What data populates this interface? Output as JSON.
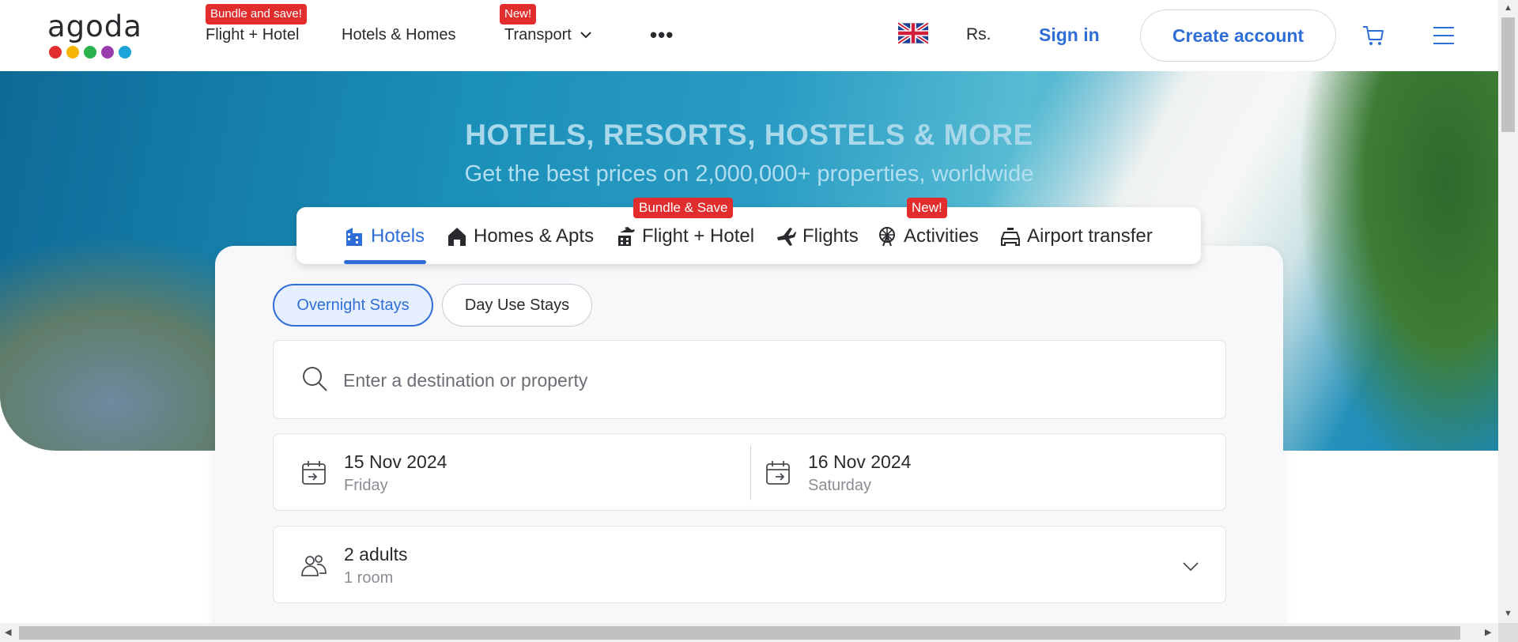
{
  "header": {
    "logo_text": "agoda",
    "logo_dot_colors": [
      "#e12d2d",
      "#f4b400",
      "#2bb24c",
      "#9b3ead",
      "#1ba4d8"
    ],
    "nav": [
      {
        "label": "Flight + Hotel",
        "badge": "Bundle and save!"
      },
      {
        "label": "Hotels & Homes"
      },
      {
        "label": "Transport",
        "badge": "New!"
      }
    ],
    "more_label": "•••",
    "currency": "Rs.",
    "sign_in": "Sign in",
    "create_account": "Create account",
    "accent_color": "#2f6ed7",
    "badge_color": "#e12d2d"
  },
  "hero": {
    "title": "HOTELS, RESORTS, HOSTELS & MORE",
    "subtitle": "Get the best prices on 2,000,000+ properties, worldwide"
  },
  "search": {
    "tabs": [
      {
        "label": "Hotels",
        "icon": "hotel-icon",
        "active": true
      },
      {
        "label": "Homes & Apts",
        "icon": "home-icon"
      },
      {
        "label": "Flight + Hotel",
        "icon": "flight-hotel-icon",
        "badge": "Bundle & Save"
      },
      {
        "label": "Flights",
        "icon": "plane-icon"
      },
      {
        "label": "Activities",
        "icon": "ferris-wheel-icon",
        "badge": "New!"
      },
      {
        "label": "Airport transfer",
        "icon": "car-icon"
      }
    ],
    "stay_types": [
      "Overnight Stays",
      "Day Use Stays"
    ],
    "destination_placeholder": "Enter a destination or property",
    "check_in": {
      "date": "15 Nov 2024",
      "day": "Friday"
    },
    "check_out": {
      "date": "16 Nov 2024",
      "day": "Saturday"
    },
    "guests": {
      "adults": "2 adults",
      "rooms": "1 room"
    }
  }
}
